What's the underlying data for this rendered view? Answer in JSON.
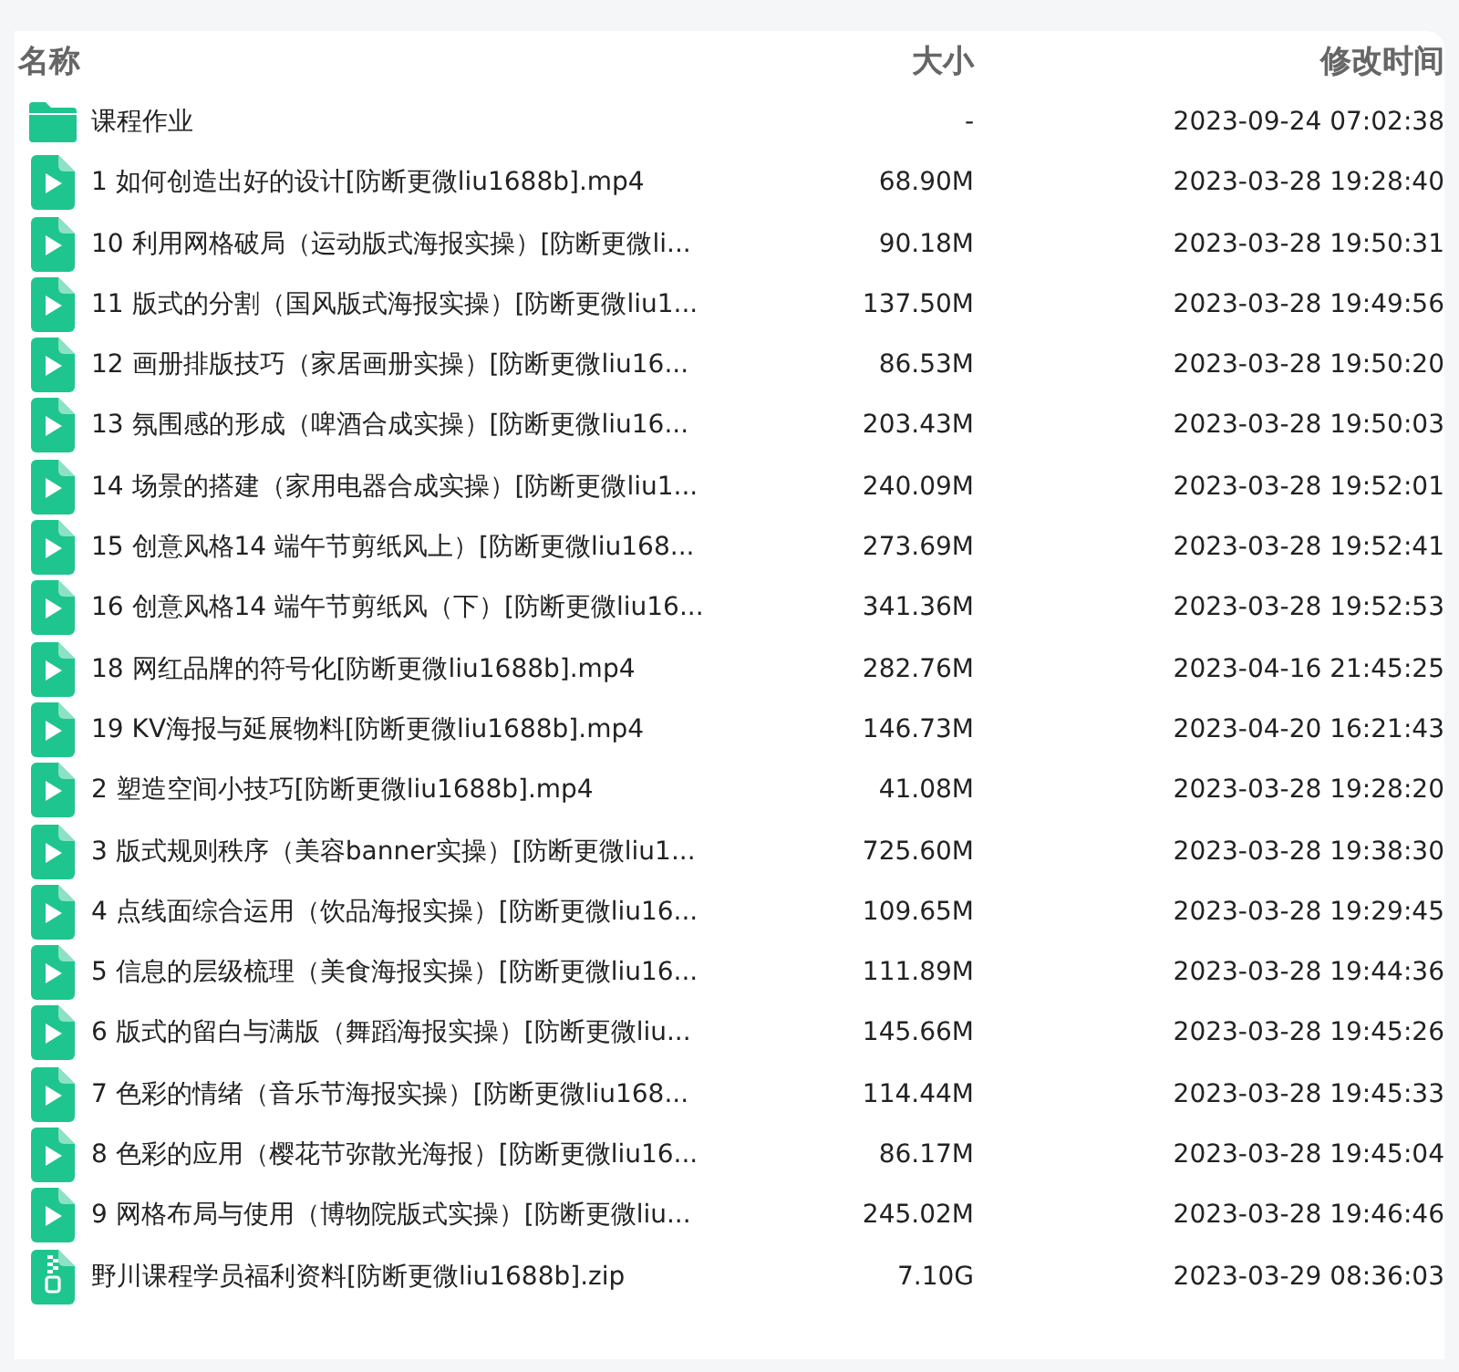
{
  "columns": [
    {
      "label": "名称"
    },
    {
      "label": "大小"
    },
    {
      "label": "修改时间"
    }
  ],
  "files": [
    {
      "kind": "folder",
      "name": "课程作业",
      "size": "-",
      "modified": "2023-09-24 07:02:38"
    },
    {
      "kind": "video",
      "name": "1 如何创造出好的设计[防断更微liu1688b].mp4",
      "size": "68.90M",
      "modified": "2023-03-28 19:28:40"
    },
    {
      "kind": "video",
      "name": "10 利用网格破局（运动版式海报实操）[防断更微li...",
      "size": "90.18M",
      "modified": "2023-03-28 19:50:31"
    },
    {
      "kind": "video",
      "name": "11 版式的分割（国风版式海报实操）[防断更微liu1...",
      "size": "137.50M",
      "modified": "2023-03-28 19:49:56"
    },
    {
      "kind": "video",
      "name": "12 画册排版技巧（家居画册实操）[防断更微liu16...",
      "size": "86.53M",
      "modified": "2023-03-28 19:50:20"
    },
    {
      "kind": "video",
      "name": "13 氛围感的形成（啤酒合成实操）[防断更微liu16...",
      "size": "203.43M",
      "modified": "2023-03-28 19:50:03"
    },
    {
      "kind": "video",
      "name": "14 场景的搭建（家用电器合成实操）[防断更微liu1...",
      "size": "240.09M",
      "modified": "2023-03-28 19:52:01"
    },
    {
      "kind": "video",
      "name": "15 创意风格14 端午节剪纸风上）[防断更微liu168...",
      "size": "273.69M",
      "modified": "2023-03-28 19:52:41"
    },
    {
      "kind": "video",
      "name": "16 创意风格14 端午节剪纸风（下）[防断更微liu16...",
      "size": "341.36M",
      "modified": "2023-03-28 19:52:53"
    },
    {
      "kind": "video",
      "name": "18 网红品牌的符号化[防断更微liu1688b].mp4",
      "size": "282.76M",
      "modified": "2023-04-16 21:45:25"
    },
    {
      "kind": "video",
      "name": "19 KV海报与延展物料[防断更微liu1688b].mp4",
      "size": "146.73M",
      "modified": "2023-04-20 16:21:43"
    },
    {
      "kind": "video",
      "name": "2 塑造空间小技巧[防断更微liu1688b].mp4",
      "size": "41.08M",
      "modified": "2023-03-28 19:28:20"
    },
    {
      "kind": "video",
      "name": "3 版式规则秩序（美容banner实操）[防断更微liu1...",
      "size": "725.60M",
      "modified": "2023-03-28 19:38:30"
    },
    {
      "kind": "video",
      "name": "4 点线面综合运用（饮品海报实操）[防断更微liu16...",
      "size": "109.65M",
      "modified": "2023-03-28 19:29:45"
    },
    {
      "kind": "video",
      "name": "5 信息的层级梳理（美食海报实操）[防断更微liu16...",
      "size": "111.89M",
      "modified": "2023-03-28 19:44:36"
    },
    {
      "kind": "video",
      "name": "6 版式的留白与满版（舞蹈海报实操）[防断更微liu...",
      "size": "145.66M",
      "modified": "2023-03-28 19:45:26"
    },
    {
      "kind": "video",
      "name": "7 色彩的情绪（音乐节海报实操）[防断更微liu168...",
      "size": "114.44M",
      "modified": "2023-03-28 19:45:33"
    },
    {
      "kind": "video",
      "name": "8 色彩的应用（樱花节弥散光海报）[防断更微liu16...",
      "size": "86.17M",
      "modified": "2023-03-28 19:45:04"
    },
    {
      "kind": "video",
      "name": "9 网格布局与使用（博物院版式实操）[防断更微liu...",
      "size": "245.02M",
      "modified": "2023-03-28 19:46:46"
    },
    {
      "kind": "zip",
      "name": "野川课程学员福利资料[防断更微liu1688b].zip",
      "size": "7.10G",
      "modified": "2023-03-29 08:36:03"
    }
  ]
}
